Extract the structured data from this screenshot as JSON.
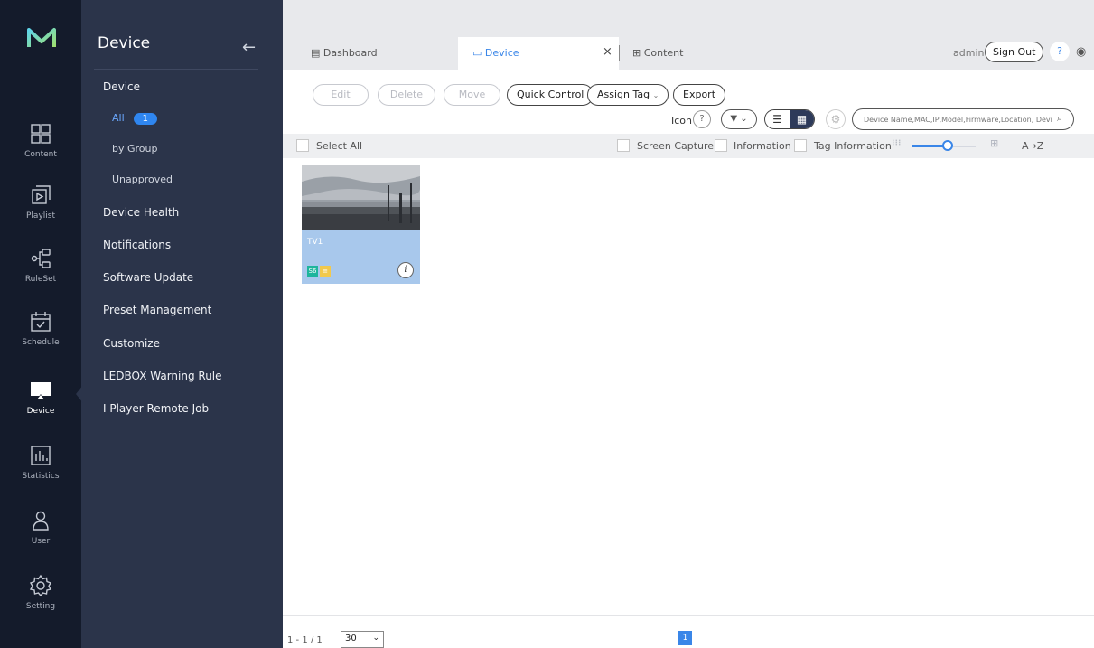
{
  "app": {
    "logo": "M-logo"
  },
  "rail": [
    {
      "label": "Content",
      "icon": "content-icon"
    },
    {
      "label": "Playlist",
      "icon": "playlist-icon"
    },
    {
      "label": "RuleSet",
      "icon": "ruleset-icon"
    },
    {
      "label": "Schedule",
      "icon": "schedule-icon"
    },
    {
      "label": "Device",
      "icon": "device-icon"
    },
    {
      "label": "Statistics",
      "icon": "statistics-icon"
    },
    {
      "label": "User",
      "icon": "user-icon"
    },
    {
      "label": "Setting",
      "icon": "setting-icon"
    }
  ],
  "sidebar": {
    "title": "Device",
    "back_icon": "←",
    "items": [
      {
        "label": "Device"
      },
      {
        "label": "All",
        "count": "1"
      },
      {
        "label": "by Group"
      },
      {
        "label": "Unapproved"
      },
      {
        "label": "Device Health"
      },
      {
        "label": "Notifications"
      },
      {
        "label": "Software Update"
      },
      {
        "label": "Preset Management"
      },
      {
        "label": "Customize"
      },
      {
        "label": "LEDBOX Warning Rule"
      },
      {
        "label": "I Player Remote Job"
      }
    ]
  },
  "tabs": [
    {
      "label": "Dashboard",
      "icon": "▤"
    },
    {
      "label": "Device",
      "icon": "▭"
    },
    {
      "label": "Content",
      "icon": "⊞"
    }
  ],
  "header": {
    "user": "admin",
    "sign_out": "Sign Out",
    "help": "?",
    "globe": "◉",
    "close": "×"
  },
  "toolbar": {
    "edit": "Edit",
    "delete": "Delete",
    "move": "Move",
    "quick_control": "Quick Control",
    "assign_tag": "Assign Tag",
    "export": "Export",
    "icon_label": "Icon",
    "filter": "▼",
    "search_placeholder": "Device Name,MAC,IP,Model,Firmware,Location, Devi"
  },
  "bar": {
    "select_all": "Select All",
    "screen_capture": "Screen Capture",
    "information": "Information",
    "tag_information": "Tag Information",
    "sort": "A→Z",
    "size_level": 0.55
  },
  "device_card": {
    "name": "TV1",
    "chip1": "S6",
    "chip2": "≡",
    "info": "i"
  },
  "footer": {
    "range": "1 - 1 / 1",
    "page_size": "30",
    "page": "1"
  },
  "colors": {
    "accent": "#3a86e8",
    "rail_bg": "#141b2b",
    "sidebar_bg": "#2b344a",
    "card_bg": "#a8c8ec",
    "chip_green": "#1eb59c",
    "chip_yellow": "#f2c94c"
  }
}
